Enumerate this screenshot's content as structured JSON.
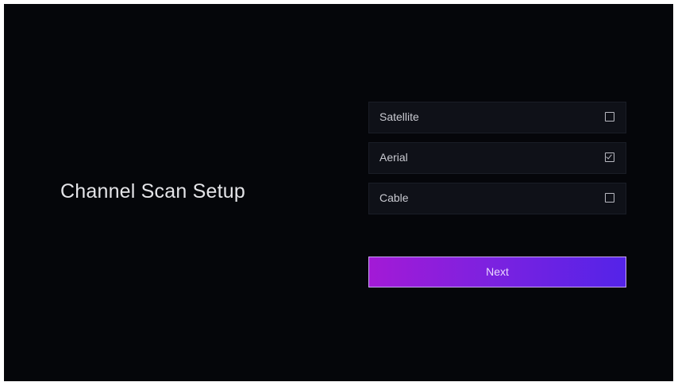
{
  "page": {
    "title": "Channel Scan Setup"
  },
  "options": [
    {
      "label": "Satellite",
      "checked": false
    },
    {
      "label": "Aerial",
      "checked": true
    },
    {
      "label": "Cable",
      "checked": false
    }
  ],
  "next_button": {
    "label": "Next"
  },
  "colors": {
    "background": "#05060a",
    "option_background": "#0f1118",
    "button_gradient_start": "#a31ad6",
    "button_gradient_end": "#5423e8",
    "text": "#e4e4e8"
  },
  "icons": {
    "checkbox_unchecked": "checkbox-unchecked-icon",
    "checkbox_checked": "checkbox-checked-icon"
  }
}
